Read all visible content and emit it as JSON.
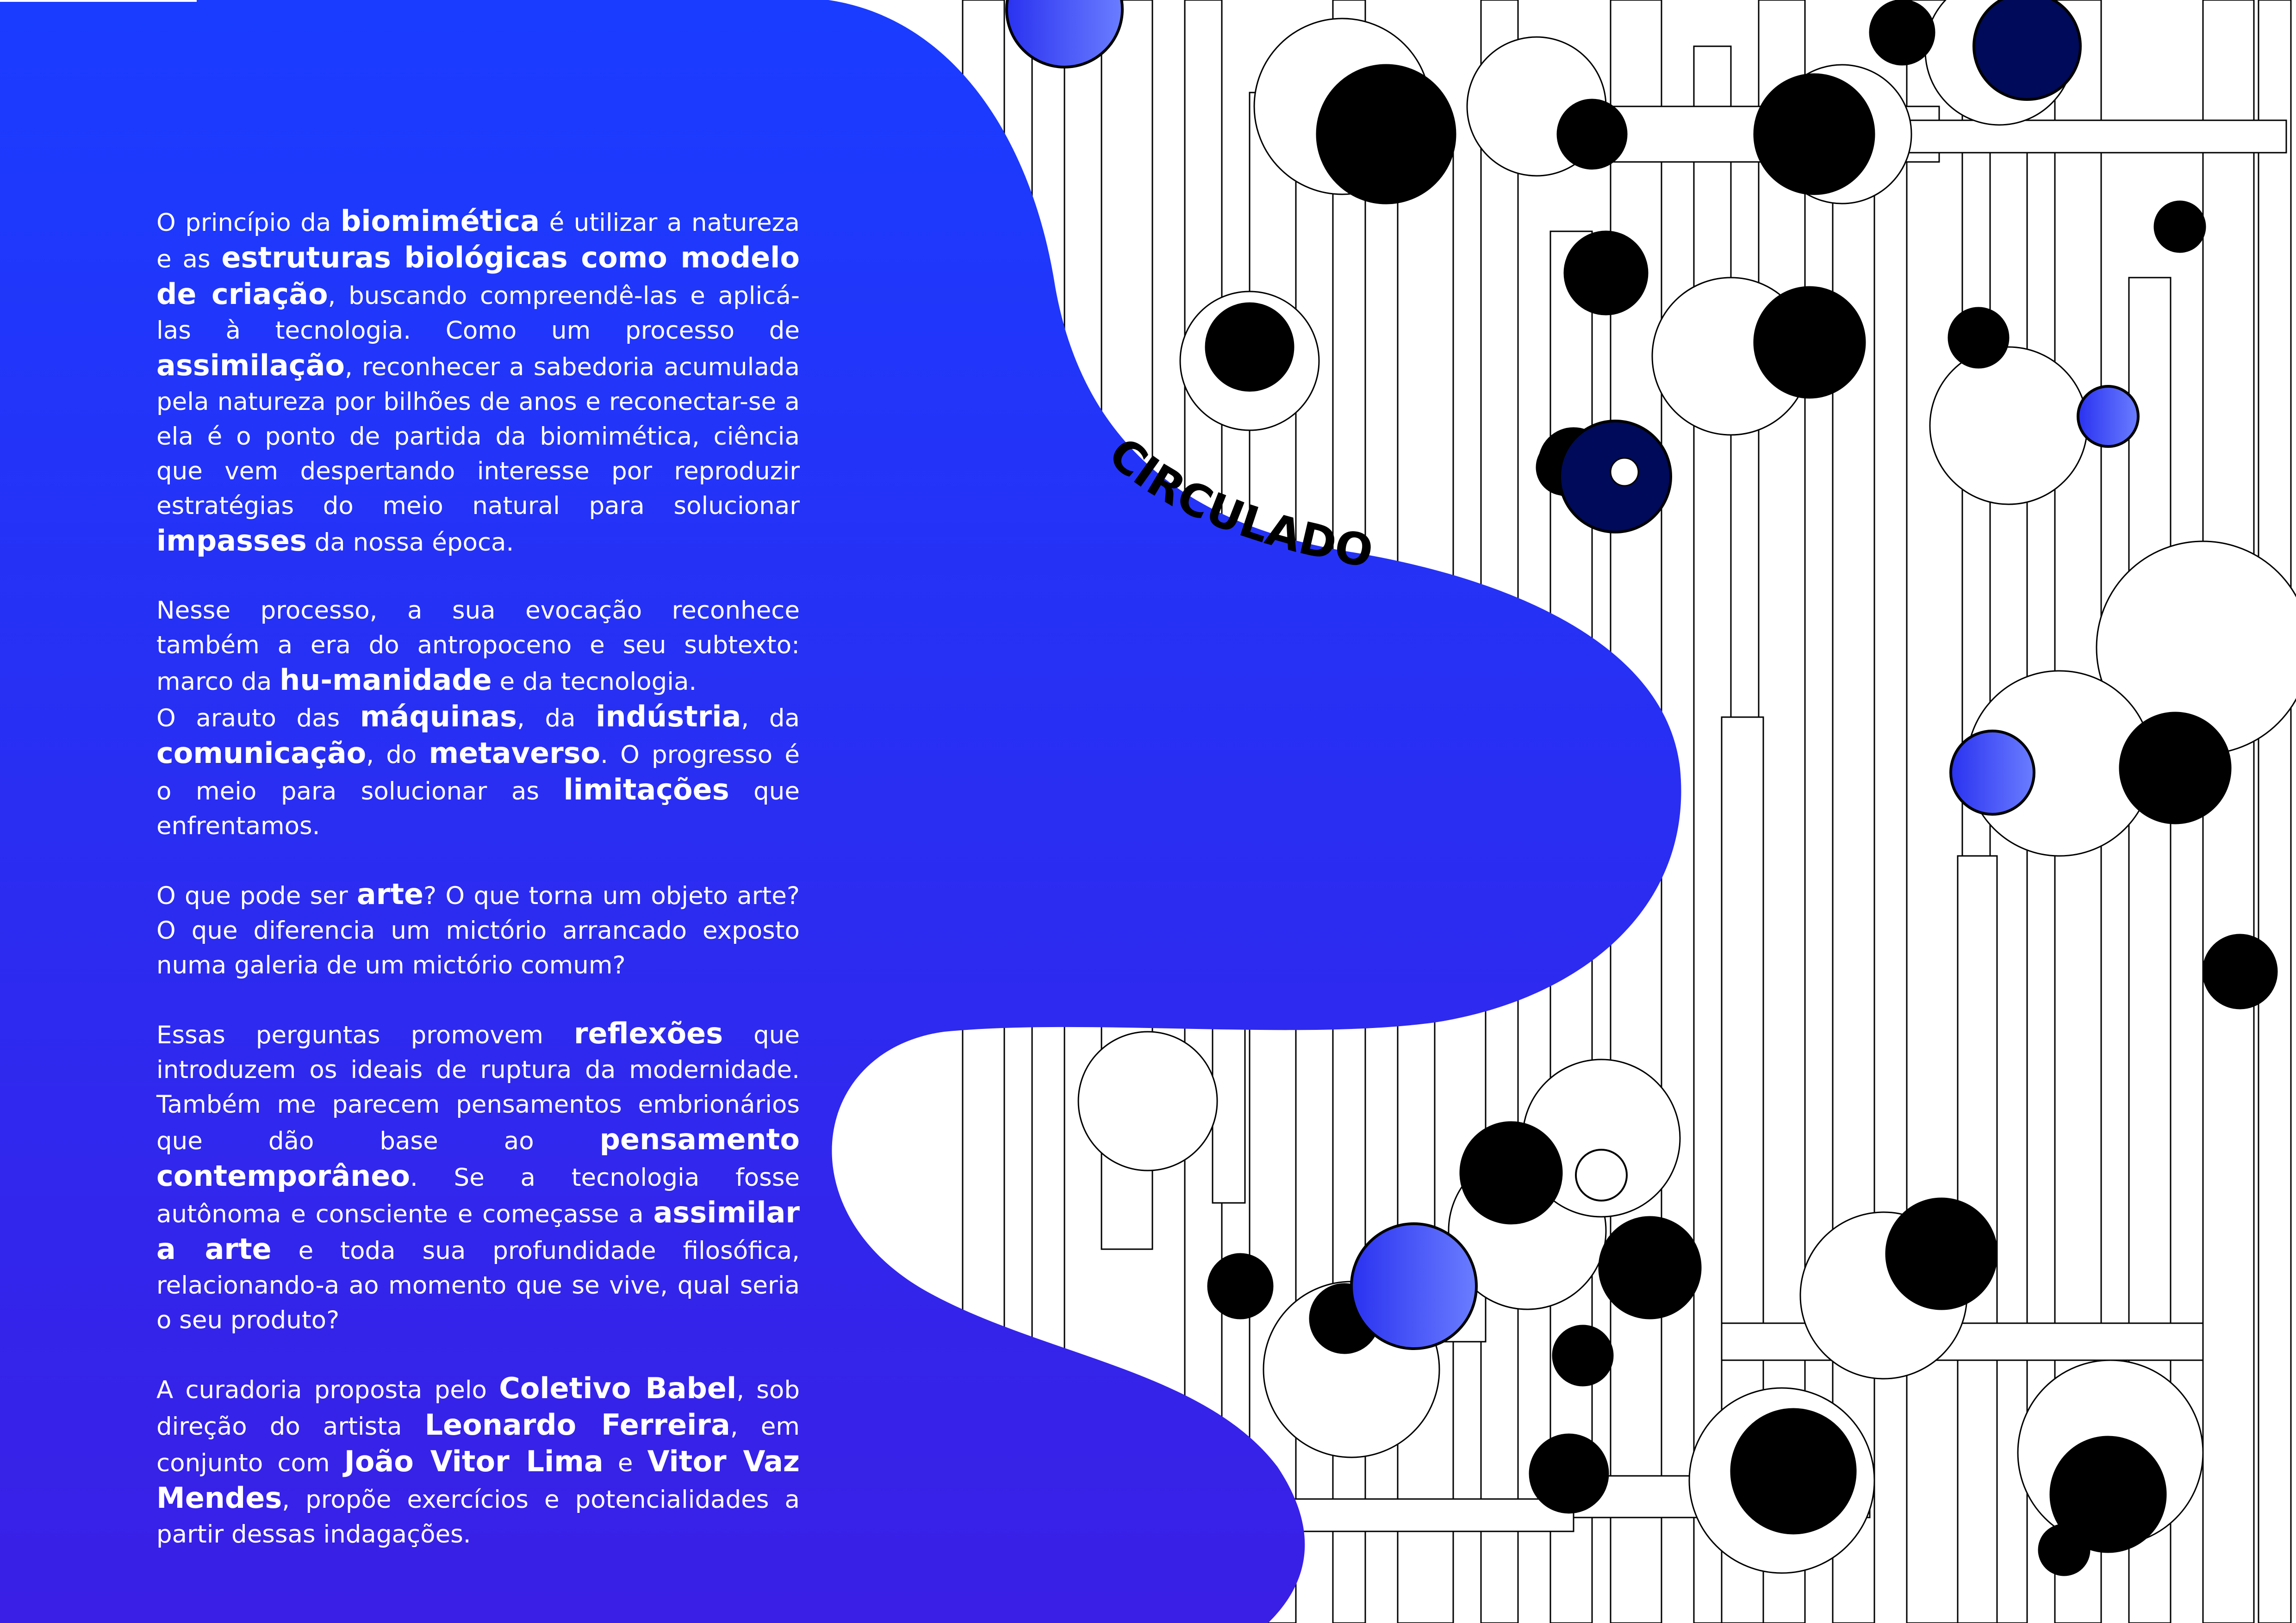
{
  "colors": {
    "blob_top": "#1a3cff",
    "blob_bottom": "#3a1fe6",
    "ink": "#000000",
    "navy": "#000a5a",
    "accent_blue": "#2a32f0"
  },
  "curved_title": "CIRCULADO",
  "paragraphs": [
    {
      "segments": [
        {
          "text": "O princípio da "
        },
        {
          "text": "biomimética",
          "bold": true
        },
        {
          "text": " é utilizar a natureza e as "
        },
        {
          "text": "estruturas biológicas como modelo de criação",
          "bold": true
        },
        {
          "text": ", buscando compreendê-las e aplicá-las à tecnologia. Como um processo de "
        },
        {
          "text": "assimilação",
          "bold": true
        },
        {
          "text": ", reconhecer a sabedoria acumulada pela natureza por bilhões de anos e reconectar-se a ela é o ponto de partida da biomimética, ciência que vem despertando interesse por reproduzir estratégias do meio natural para solucionar "
        },
        {
          "text": "impasses",
          "bold": true
        },
        {
          "text": " da nossa época."
        }
      ]
    },
    {
      "tight": true,
      "segments": [
        {
          "text": "Nesse processo, a sua evocação reconhece também a era do antropoceno e seu subtexto: marco da "
        },
        {
          "text": "hu-manidade",
          "bold": true
        },
        {
          "text": " e da tecnologia."
        }
      ]
    },
    {
      "segments": [
        {
          "text": "O arauto das "
        },
        {
          "text": "máquinas",
          "bold": true
        },
        {
          "text": ", da "
        },
        {
          "text": "indústria",
          "bold": true
        },
        {
          "text": ", da "
        },
        {
          "text": "comunicação",
          "bold": true
        },
        {
          "text": ", do "
        },
        {
          "text": "metaverso",
          "bold": true
        },
        {
          "text": ". O progresso é o meio para solucionar as "
        },
        {
          "text": "limitações",
          "bold": true
        },
        {
          "text": " que enfrentamos."
        }
      ]
    },
    {
      "segments": [
        {
          "text": "O que pode ser "
        },
        {
          "text": "arte",
          "bold": true
        },
        {
          "text": "? O que torna um objeto arte? O que diferencia um mictório arrancado exposto numa galeria de um mictório comum?"
        }
      ]
    },
    {
      "segments": [
        {
          "text": "Essas perguntas promovem "
        },
        {
          "text": "reflexões",
          "bold": true
        },
        {
          "text": " que introduzem os ideais de ruptura da modernidade. Também me parecem pensamentos embrionários que dão base ao "
        },
        {
          "text": "pensamento contemporâneo",
          "bold": true
        },
        {
          "text": ". Se a tecnologia fosse autônoma e consciente e começasse a "
        },
        {
          "text": "assimilar a arte",
          "bold": true
        },
        {
          "text": " e toda sua profundidade filosófica, relacionando-a ao momento que se vive, qual seria o seu produto?"
        }
      ]
    },
    {
      "segments": [
        {
          "text": "A curadoria proposta pelo "
        },
        {
          "text": "Coletivo Babel",
          "bold": true
        },
        {
          "text": ", sob direção do artista "
        },
        {
          "text": "Leonardo Ferreira",
          "bold": true
        },
        {
          "text": ", em conjunto com "
        },
        {
          "text": "João Vitor Lima",
          "bold": true
        },
        {
          "text": " e "
        },
        {
          "text": "Vitor Vaz Mendes",
          "bold": true
        },
        {
          "text": ", propõe exercícios e potencialidades a partir dessas indagações."
        }
      ]
    }
  ]
}
